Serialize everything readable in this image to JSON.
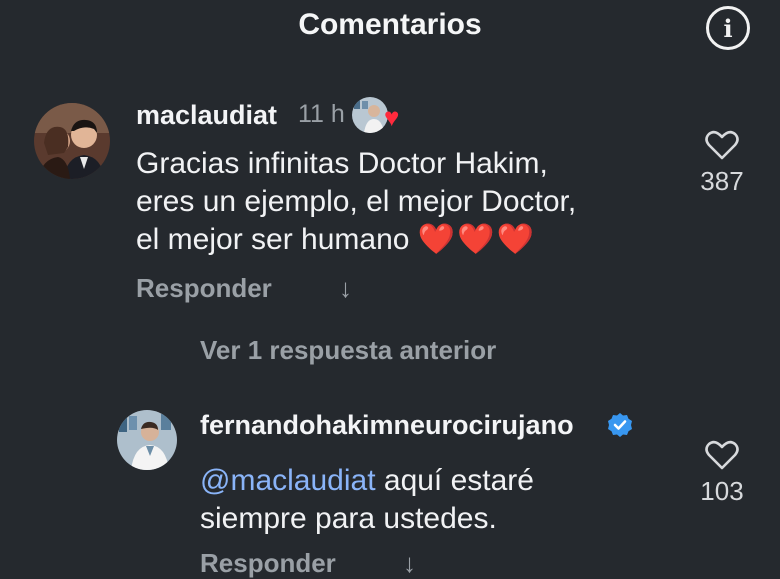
{
  "header": {
    "title": "Comentarios",
    "info_icon": "i"
  },
  "comments": [
    {
      "username": "maclaudiat",
      "time": "11 h",
      "text_lines": [
        "Gracias infinitas Doctor Hakim,",
        "eres un ejemplo, el mejor Doctor,",
        "el mejor ser humano"
      ],
      "emoji": "❤️❤️❤️",
      "reply_label": "Responder",
      "likes": "387"
    }
  ],
  "view_previous": "Ver 1 respuesta anterior",
  "reply": {
    "username": "fernandohakimneurocirujano",
    "verified": true,
    "mention": "@maclaudiat",
    "text_line1_rest": " aquí estaré",
    "text_line2": "siempre para ustedes.",
    "reply_label": "Responder",
    "likes": "103"
  },
  "colors": {
    "background": "#25292e",
    "mention": "#8ab4f8",
    "verified": "#3897f0",
    "heart": "#ff2a3d"
  }
}
